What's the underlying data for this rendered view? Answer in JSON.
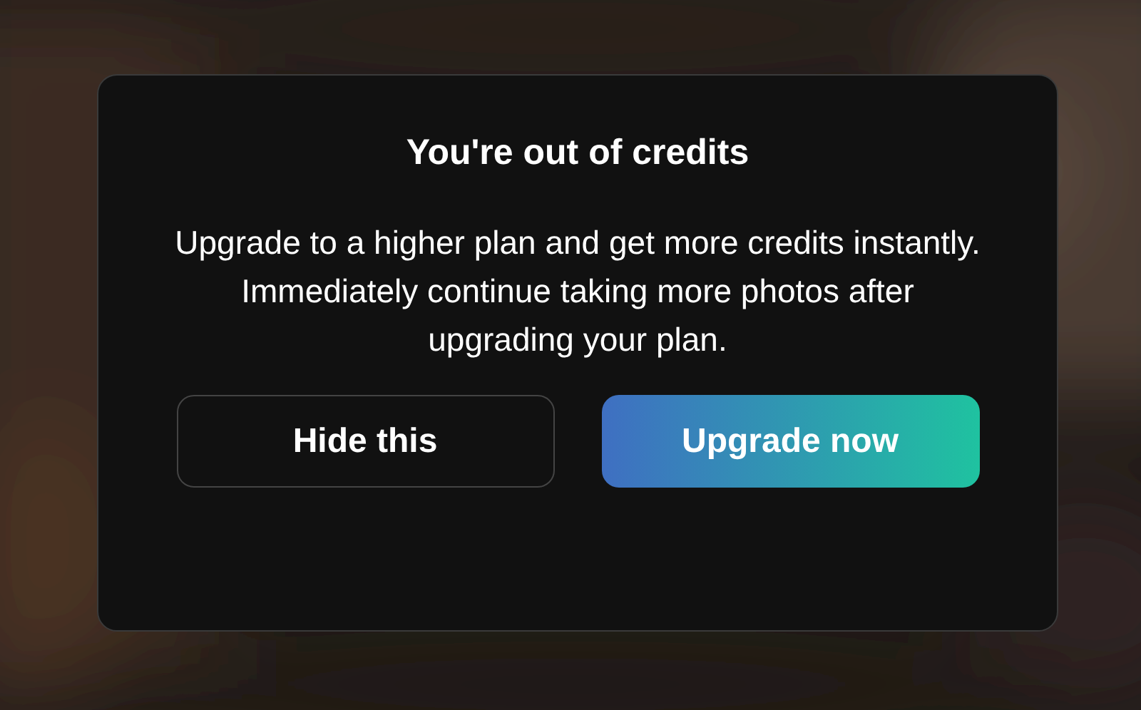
{
  "dialog": {
    "title": "You're out of credits",
    "message": "Upgrade to a higher plan and get more credits instantly. Immediately continue taking more photos after upgrading your plan.",
    "buttons": [
      {
        "label": "Hide this",
        "kind": "secondary"
      },
      {
        "label": "Upgrade now",
        "kind": "primary"
      }
    ]
  }
}
